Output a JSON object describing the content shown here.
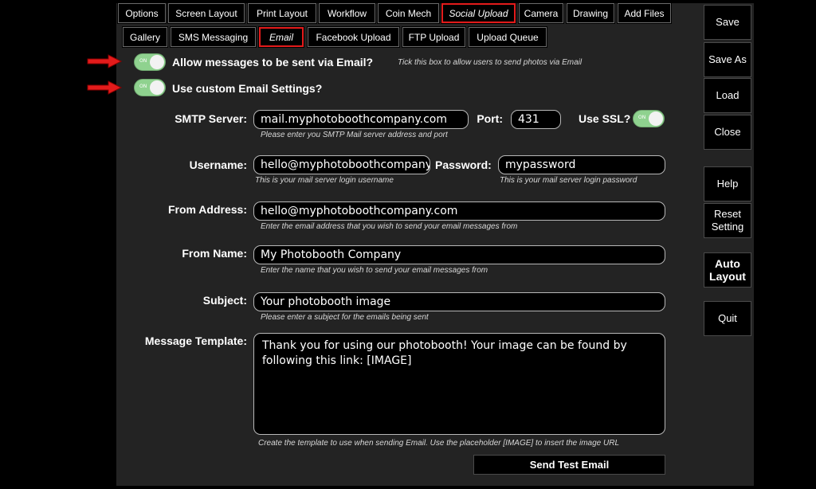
{
  "tabs_top": [
    {
      "label": "Options",
      "active": false
    },
    {
      "label": "Screen Layout",
      "active": false
    },
    {
      "label": "Print Layout",
      "active": false
    },
    {
      "label": "Workflow",
      "active": false
    },
    {
      "label": "Coin Mech",
      "active": false
    },
    {
      "label": "Social Upload",
      "active": true
    },
    {
      "label": "Camera",
      "active": false
    },
    {
      "label": "Drawing",
      "active": false
    },
    {
      "label": "Add Files",
      "active": false
    }
  ],
  "tabs_sub": [
    {
      "label": "Gallery",
      "active": false
    },
    {
      "label": "SMS Messaging",
      "active": false
    },
    {
      "label": "Email",
      "active": true
    },
    {
      "label": "Facebook Upload",
      "active": false
    },
    {
      "label": "FTP Upload",
      "active": false
    },
    {
      "label": "Upload Queue",
      "active": false
    }
  ],
  "allow_email": {
    "label": "Allow messages to be sent via Email?",
    "toggle": "ON",
    "hint": "Tick this box to allow users to send photos via Email"
  },
  "custom_settings": {
    "label": "Use custom Email Settings?",
    "toggle": "ON"
  },
  "smtp": {
    "label": "SMTP Server:",
    "value": "mail.myphotoboothcompany.com",
    "hint": "Please enter you SMTP Mail server address and port"
  },
  "port": {
    "label": "Port:",
    "value": "431"
  },
  "ssl": {
    "label": "Use SSL?",
    "toggle": "ON"
  },
  "username": {
    "label": "Username:",
    "value": "hello@myphotoboothcompany.co",
    "hint": "This is your mail server login username"
  },
  "password": {
    "label": "Password:",
    "value": "mypassword",
    "hint": "This is your mail server login password"
  },
  "from_address": {
    "label": "From Address:",
    "value": "hello@myphotoboothcompany.com",
    "hint": "Enter the email address that you wish to send your email messages from"
  },
  "from_name": {
    "label": "From Name:",
    "value": "My Photobooth Company",
    "hint": "Enter the name that you wish to send your email messages from"
  },
  "subject": {
    "label": "Subject:",
    "value": "Your photobooth image",
    "hint": "Please enter a subject for the emails being sent"
  },
  "message_template": {
    "label": "Message Template:",
    "value": "Thank you for using our photobooth! Your image can be found by following this link: [IMAGE]",
    "hint": "Create the template to use when sending Email. Use the placeholder [IMAGE] to insert the image URL"
  },
  "send_test_label": "Send Test Email",
  "side_buttons": {
    "save": "Save",
    "save_as": "Save As",
    "load": "Load",
    "close": "Close",
    "help": "Help",
    "reset_setting": "Reset Setting",
    "auto_layout": "Auto Layout",
    "quit": "Quit"
  },
  "colors": {
    "active_tab_border": "#e31b1b",
    "toggle_on": "#8fd28f",
    "arrow": "#e31b1b"
  }
}
